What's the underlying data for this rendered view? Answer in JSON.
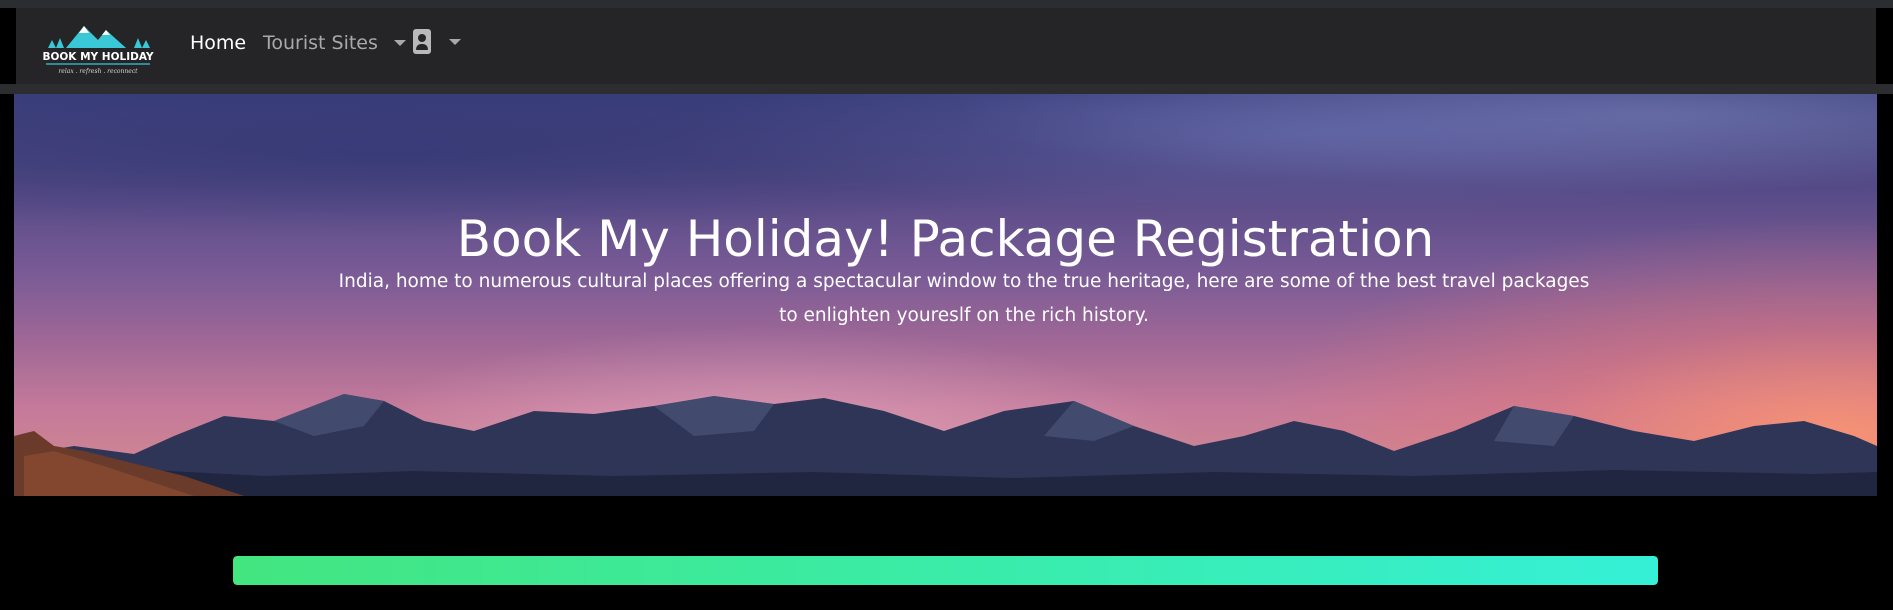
{
  "navbar": {
    "logo_text": "BOOK MY HOLIDAY",
    "logo_tagline": "relax . refresh . reconnect",
    "home_label": "Home",
    "tourist_sites_label": "Tourist Sites",
    "user_icon": "user-icon"
  },
  "hero": {
    "title": "Book My Holiday! Package Registration",
    "subtitle": "India, home to numerous cultural places offering a spectacular window to the true heritage, here are some of the best travel packages to enlighten youreslf on the rich history."
  },
  "progress": {
    "value": 1.0
  },
  "colors": {
    "navbar_bg": "#252426",
    "page_bg": "#000000",
    "progress_start": "#43e57f",
    "progress_end": "#35f0d6",
    "logo_accent": "#3ac8d8"
  }
}
